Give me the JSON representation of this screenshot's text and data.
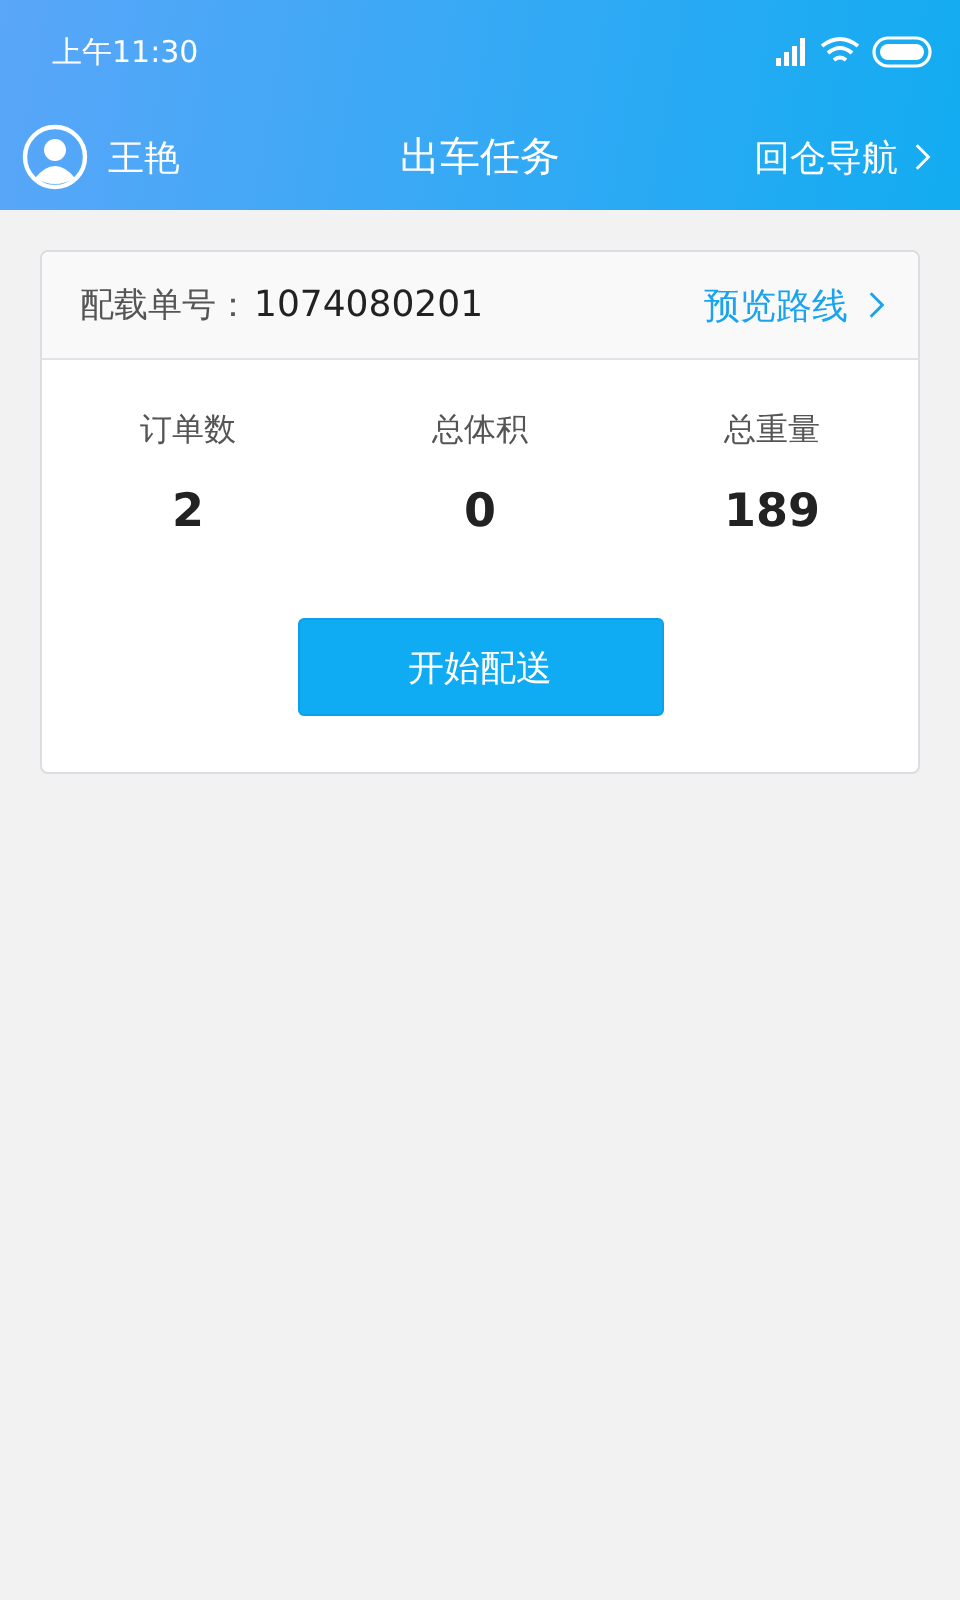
{
  "status_bar": {
    "time": "上午11:30"
  },
  "header": {
    "user_name": "王艳",
    "title": "出车任务",
    "nav_link": "回仓导航"
  },
  "task": {
    "load_label": "配载单号：",
    "load_number": "1074080201",
    "route_link": "预览路线",
    "stats": [
      {
        "label": "订单数",
        "value": "2"
      },
      {
        "label": "总体积",
        "value": "0"
      },
      {
        "label": "总重量",
        "value": "189"
      }
    ],
    "start_button": "开始配送"
  }
}
